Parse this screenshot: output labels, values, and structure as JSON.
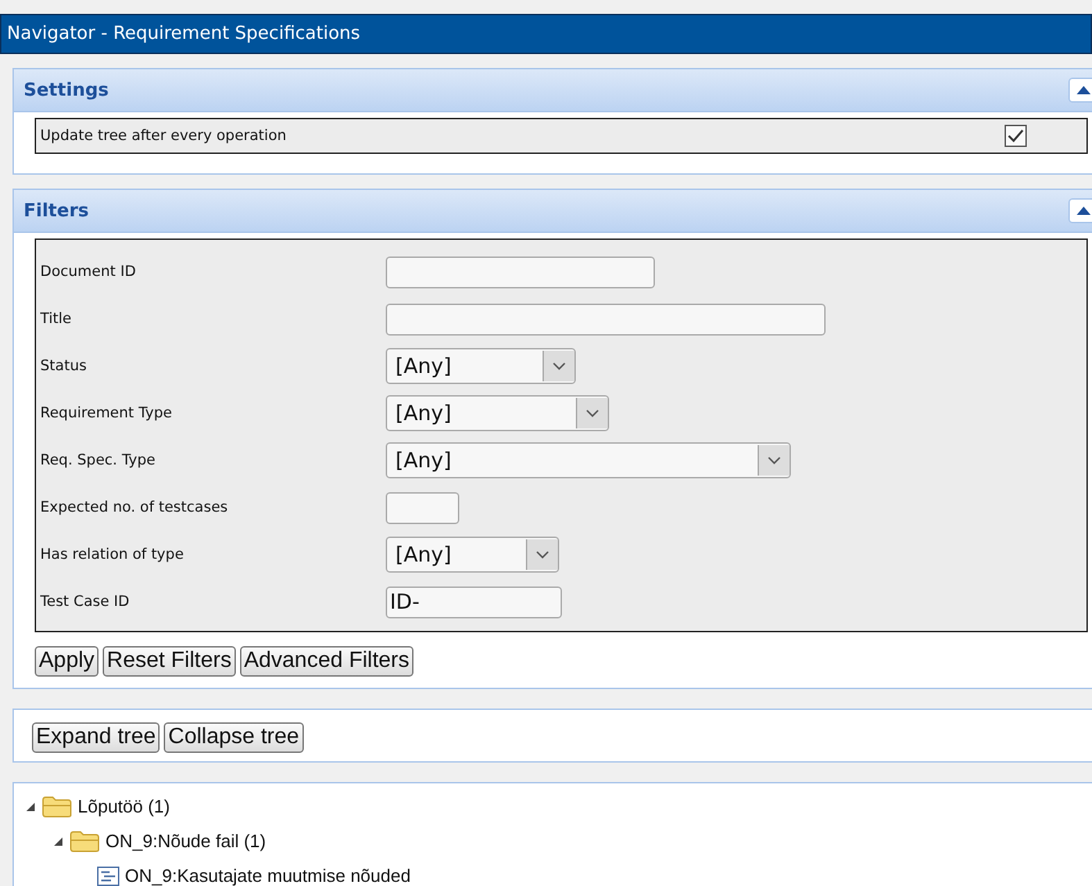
{
  "window": {
    "title": "Navigator - Requirement Specifications"
  },
  "settings": {
    "title": "Settings",
    "expanded": true,
    "options": [
      {
        "label": "Update tree after every operation",
        "checked": true
      }
    ]
  },
  "filters": {
    "title": "Filters",
    "expanded": true,
    "fields": [
      {
        "label": "Document ID",
        "kind": "text"
      },
      {
        "label": "Title",
        "kind": "text"
      },
      {
        "label": "Status",
        "kind": "select",
        "value": "[Any]"
      },
      {
        "label": "Requirement Type",
        "kind": "select",
        "value": "[Any]"
      },
      {
        "label": "Req. Spec. Type",
        "kind": "select",
        "value": "[Any]"
      },
      {
        "label": "Expected no. of testcases",
        "kind": "text"
      },
      {
        "label": "Has relation of type",
        "kind": "select",
        "value": "[Any]"
      },
      {
        "label": "Test Case ID",
        "kind": "text",
        "value": "ID-"
      }
    ],
    "buttons": [
      "Apply",
      "Reset Filters",
      "Advanced Filters"
    ]
  },
  "tree_buttons": [
    "Expand tree",
    "Collapse tree"
  ],
  "tree": [
    {
      "label": "Lõputöö (1)",
      "kind": "folder",
      "expanded": true,
      "children": [
        {
          "label": "ON_9:Nõude fail (1)",
          "kind": "folder",
          "expanded": true,
          "children": [
            {
              "label": "ON_9:Kasutajate muutmise nõuded",
              "kind": "document"
            }
          ]
        }
      ]
    }
  ]
}
